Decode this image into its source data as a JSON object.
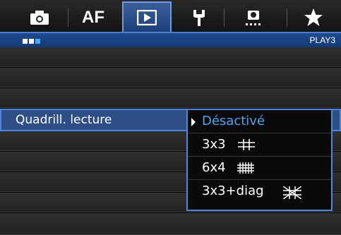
{
  "tabs": [
    {
      "name": "camera-tab",
      "icon": "camera-icon"
    },
    {
      "name": "af-tab",
      "label": "AF"
    },
    {
      "name": "playback-tab",
      "icon": "play-icon",
      "active": true
    },
    {
      "name": "setup-tab",
      "icon": "wrench-icon"
    },
    {
      "name": "custom-tab",
      "icon": "custom-function-icon"
    },
    {
      "name": "mymenu-tab",
      "icon": "star-icon"
    }
  ],
  "subheader": {
    "page_label": "PLAY3",
    "page_dots": 3,
    "active_page": 3
  },
  "menu": {
    "rows": [
      {
        "label": ""
      },
      {
        "label": ""
      },
      {
        "label": "Quadrill. lecture",
        "selected": true
      },
      {
        "label": ""
      },
      {
        "label": ""
      },
      {
        "label": ""
      },
      {
        "label": ""
      }
    ]
  },
  "dropdown": {
    "options": [
      {
        "label": "Désactivé",
        "selected": true,
        "icon": ""
      },
      {
        "label": "3x3",
        "icon": "grid-3x3-icon"
      },
      {
        "label": "6x4",
        "icon": "grid-6x4-icon"
      },
      {
        "label": "3x3+diag",
        "icon": "grid-3x3-diag-icon"
      }
    ]
  },
  "colors": {
    "accent": "#4aa6f0",
    "tab_active": "#2d5391",
    "selection": "#2d4f86"
  }
}
